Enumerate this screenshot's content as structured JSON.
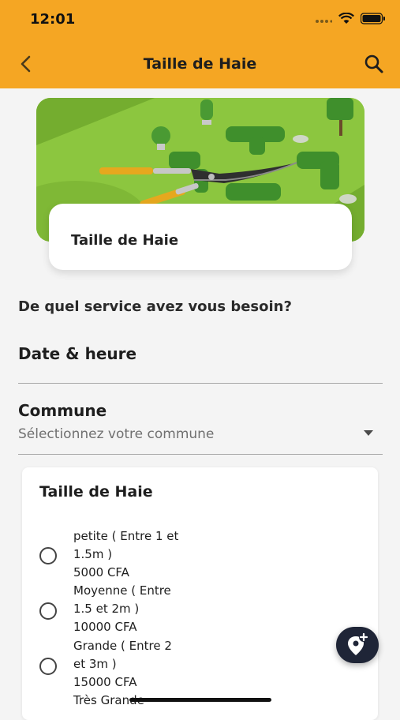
{
  "status_bar": {
    "time": "12:01"
  },
  "nav": {
    "title": "Taille de Haie"
  },
  "hero": {
    "card_title": "Taille de Haie"
  },
  "form": {
    "question": "De quel service avez vous besoin?",
    "date_label": "Date & heure",
    "commune_label": "Commune",
    "commune_placeholder": "Sélectionnez votre commune"
  },
  "options_card": {
    "title": "Taille de Haie",
    "options": [
      {
        "line1": "petite ( Entre 1 et",
        "line2": "1.5m )",
        "price": "5000 CFA"
      },
      {
        "line1": "Moyenne ( Entre",
        "line2": "1.5 et 2m )",
        "price": "10000 CFA"
      },
      {
        "line1": "Grande ( Entre 2",
        "line2": "et 3m )",
        "price": "15000 CFA"
      },
      {
        "line1": "Très Grande",
        "line2": "",
        "price": ""
      }
    ]
  },
  "icons": {
    "back": "chevron-left-icon",
    "search": "search-icon",
    "fab": "add-location-icon"
  },
  "colors": {
    "accent": "#f5a623",
    "fab": "#1f2537",
    "background": "#f4f4f4"
  }
}
